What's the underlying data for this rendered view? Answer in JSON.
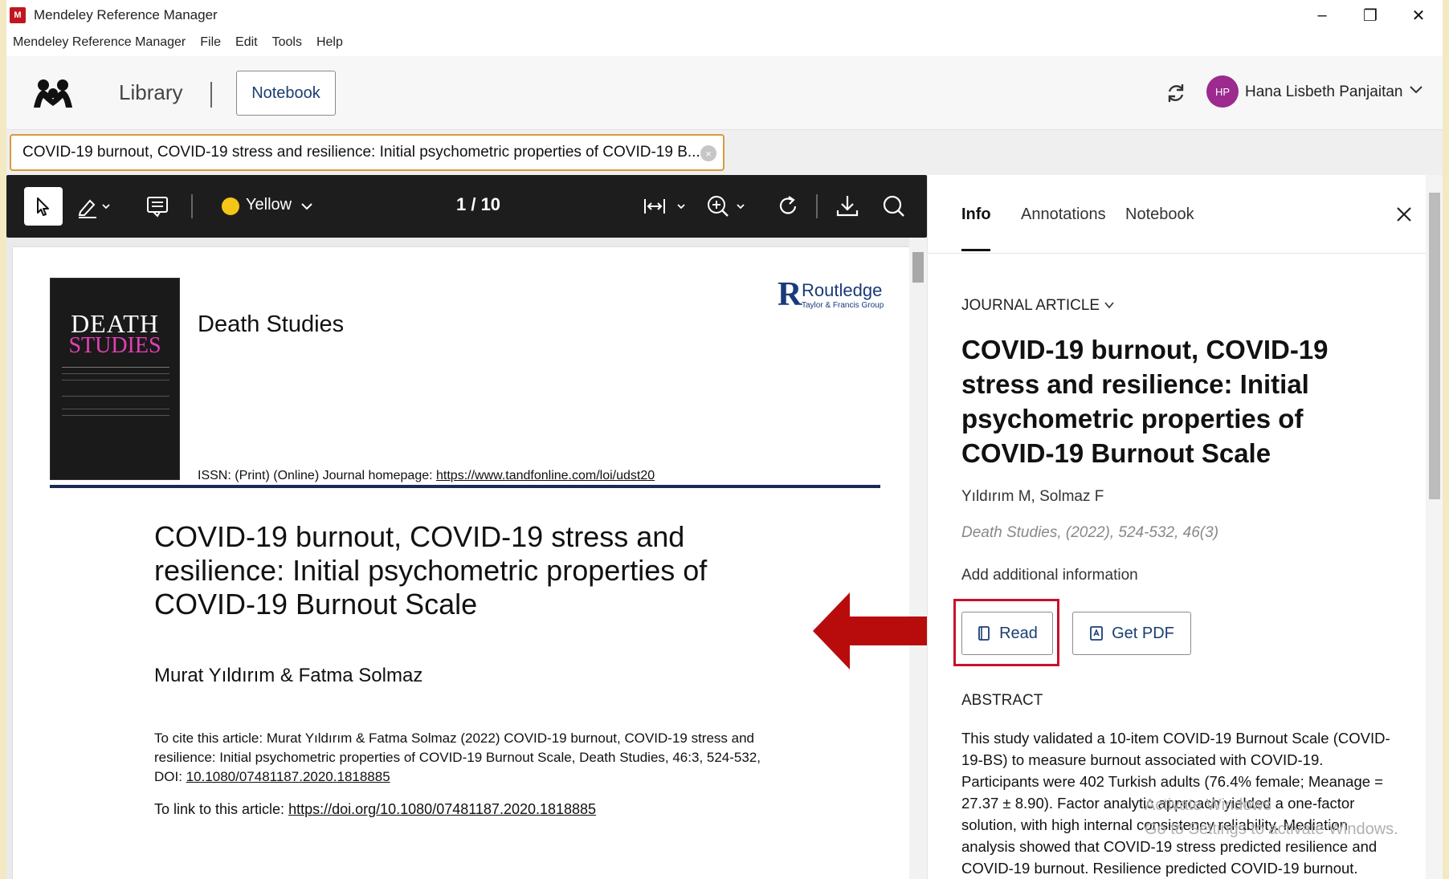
{
  "window": {
    "title": "Mendeley Reference Manager",
    "app_icon_text": "M",
    "controls": {
      "minimize": "–",
      "restore": "❐",
      "close": "✕"
    }
  },
  "menubar": [
    "Mendeley Reference Manager",
    "File",
    "Edit",
    "Tools",
    "Help"
  ],
  "header": {
    "library_label": "Library",
    "notebook_button": "Notebook",
    "user_initials": "HP",
    "user_name": "Hana Lisbeth Panjaitan"
  },
  "doc_tab": {
    "title": "COVID-19 burnout, COVID-19 stress and resilience: Initial psychometric properties of COVID-19 B...",
    "close": "×"
  },
  "pdf_toolbar": {
    "highlight_color": "Yellow",
    "page": "1 / 10",
    "highlight_color_hex": "#f5c518"
  },
  "pdf_page": {
    "cover_line1": "DEATH",
    "cover_line2": "STUDIES",
    "journal_name": "Death Studies",
    "publisher_name": "Routledge",
    "publisher_sub": "Taylor & Francis Group",
    "issn_prefix": "ISSN: (Print) (Online) Journal homepage: ",
    "journal_homepage": "https://www.tandfonline.com/loi/udst20",
    "article_title": "COVID-19 burnout, COVID-19 stress and resilience: Initial psychometric properties of COVID-19 Burnout Scale",
    "authors": "Murat Yıldırım & Fatma Solmaz",
    "cite_prefix": "To cite this article: Murat Yıldırım & Fatma Solmaz (2022) COVID-19 burnout, COVID-19 stress and resilience: Initial psychometric properties of COVID-19 Burnout Scale, Death Studies, 46:3, 524-532, DOI: ",
    "cite_doi": "10.1080/07481187.2020.1818885",
    "link_prefix": "To link to this article: ",
    "link_url": "https://doi.org/10.1080/07481187.2020.1818885"
  },
  "right_panel": {
    "tabs": [
      "Info",
      "Annotations",
      "Notebook"
    ],
    "doc_type": "JOURNAL ARTICLE",
    "title": "COVID-19 burnout, COVID-19 stress and resilience: Initial psychometric properties of COVID-19 Burnout Scale",
    "authors": "Yıldırım M, Solmaz F",
    "source": "Death Studies, (2022), 524-532, 46(3)",
    "add_info": "Add additional information",
    "read_button": "Read",
    "get_pdf_button": "Get PDF",
    "abstract_heading": "ABSTRACT",
    "abstract": "This study validated a 10-item COVID-19 Burnout Scale (COVID-19-BS) to measure burnout associated with COVID-19. Participants were 402 Turkish adults (76.4% female; Meanage = 27.37 ± 8.90). Factor analytic approach yielded a one-factor solution, with high internal consistency reliability. Mediation analysis showed that COVID-19 stress predicted resilience and COVID-19 burnout. Resilience predicted COVID-19 burnout.",
    "watermark_line1": "Activate Windows",
    "watermark_line2": "Go to Settings to activate Windows."
  },
  "colors": {
    "highlight_border": "#c8102e",
    "tab_border": "#d89a3a",
    "link_text": "#1a3e73",
    "avatar": "#9c2a8f"
  }
}
